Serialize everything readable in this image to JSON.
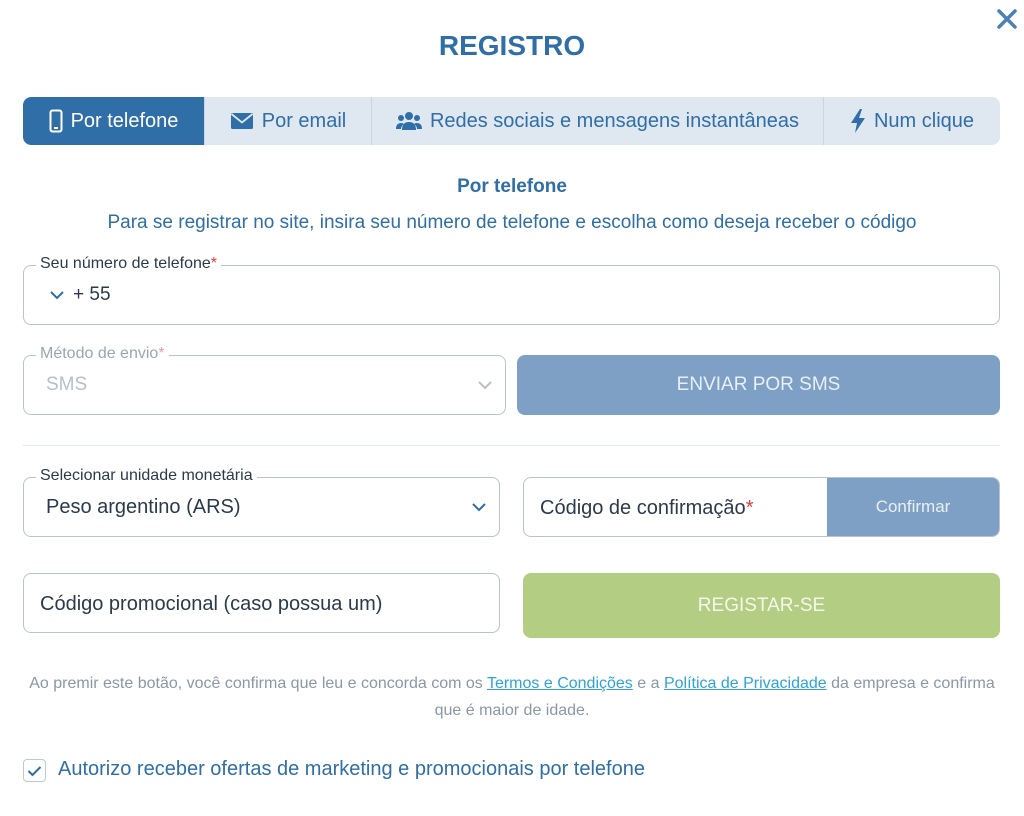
{
  "modal": {
    "title": "REGISTRO",
    "close_icon": "close-icon"
  },
  "tabs": [
    {
      "label": "Por telefone",
      "icon": "phone-icon",
      "active": true
    },
    {
      "label": "Por email",
      "icon": "envelope-icon",
      "active": false
    },
    {
      "label": "Redes sociais e mensagens instantâneas",
      "icon": "users-icon",
      "active": false
    },
    {
      "label": "Num clique",
      "icon": "lightning-icon",
      "active": false
    }
  ],
  "section": {
    "subtitle": "Por telefone",
    "description": "Para se registrar no site, insira seu número de telefone e escolha como deseja receber o código"
  },
  "phone": {
    "label": "Seu número de telefone",
    "required_mark": "*",
    "country_code": "+ 55"
  },
  "send_method": {
    "label": "Método de envio",
    "required_mark": "*",
    "value": "SMS",
    "button_label": "ENVIAR POR SMS"
  },
  "currency": {
    "label": "Selecionar unidade monetária",
    "value": "Peso argentino (ARS)"
  },
  "confirmation": {
    "placeholder": "Código de confirmação",
    "required_mark": "*",
    "button_label": "Confirmar"
  },
  "promo": {
    "placeholder": "Código promocional (caso possua um)"
  },
  "register_button": "REGISTAR-SE",
  "legal": {
    "part1": "Ao premir este botão, você confirma que leu e concorda com os ",
    "terms_link": "Termos e Condições",
    "part2": " e a ",
    "privacy_link": "Política de Privacidade",
    "part3": " da empresa e confirma que é maior de idade."
  },
  "marketing": {
    "label": "Autorizo receber ofertas de marketing e promocionais por telefone",
    "checked": true
  },
  "colors": {
    "brand": "#2f6ea6",
    "tab_bg": "#dfe7f1",
    "button_disabled": "#7da0c4",
    "register_button": "#b3cd83",
    "link": "#2fa3d9",
    "required": "#e03b3b"
  }
}
